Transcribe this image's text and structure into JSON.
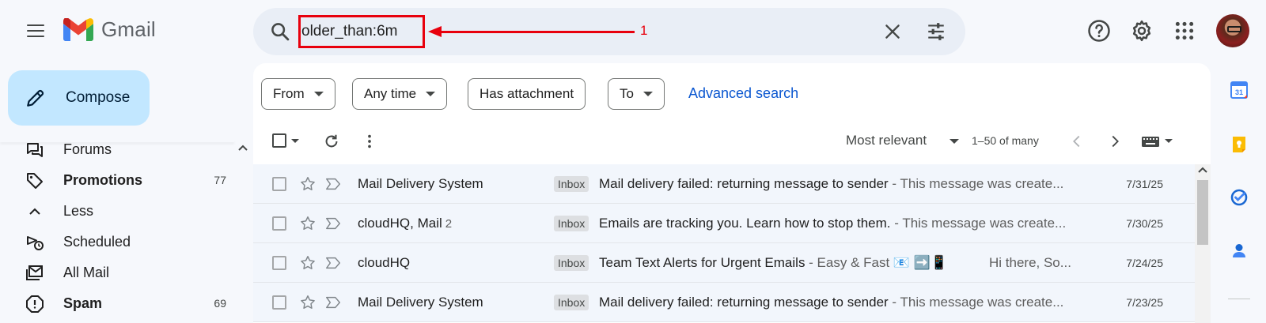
{
  "app": {
    "name": "Gmail",
    "brand_colors": {
      "red": "#ea4335",
      "blue": "#4285f4",
      "green": "#34a853",
      "yellow": "#fbbc04"
    }
  },
  "header": {
    "search_value": "older_than:6m",
    "icons": [
      "main-menu-icon",
      "search-icon",
      "clear-search-icon",
      "search-options-icon",
      "help-icon",
      "settings-icon",
      "google-apps-icon"
    ]
  },
  "annotation": {
    "number": "1",
    "color": "#e8000d"
  },
  "compose": {
    "label": "Compose"
  },
  "sidebar": {
    "items": [
      {
        "label": "Forums",
        "count": "",
        "bold": false,
        "icon": "forums-icon"
      },
      {
        "label": "Promotions",
        "count": "77",
        "bold": true,
        "icon": "promotions-icon"
      },
      {
        "label": "Less",
        "count": "",
        "bold": false,
        "icon": "chevron-up-icon"
      },
      {
        "label": "Scheduled",
        "count": "",
        "bold": false,
        "icon": "scheduled-icon"
      },
      {
        "label": "All Mail",
        "count": "",
        "bold": false,
        "icon": "all-mail-icon"
      },
      {
        "label": "Spam",
        "count": "69",
        "bold": true,
        "icon": "spam-icon"
      }
    ]
  },
  "filters": {
    "chips": [
      {
        "label": "From",
        "dropdown": true
      },
      {
        "label": "Any time",
        "dropdown": true
      },
      {
        "label": "Has attachment",
        "dropdown": false
      },
      {
        "label": "To",
        "dropdown": true
      }
    ],
    "advanced_link": "Advanced search"
  },
  "toolbar": {
    "sort_label": "Most relevant",
    "page_count": "1–50 of many"
  },
  "emails": [
    {
      "sender": "Mail Delivery System",
      "thread_count": "",
      "label": "Inbox",
      "subject": "Mail delivery failed: returning message to sender",
      "snippet": " - This message was create...",
      "extra": "",
      "date": "7/31/25"
    },
    {
      "sender": "cloudHQ, Mail",
      "thread_count": "2",
      "label": "Inbox",
      "subject": "Emails are tracking you. Learn how to stop them.",
      "snippet": " - This message was create...",
      "extra": "",
      "date": "7/30/25"
    },
    {
      "sender": "cloudHQ",
      "thread_count": "",
      "label": "Inbox",
      "subject": "Team Text Alerts for Urgent Emails",
      "snippet": " - Easy & Fast 📧 ➡️📱",
      "extra": "Hi there, So...",
      "date": "7/24/25"
    },
    {
      "sender": "Mail Delivery System",
      "thread_count": "",
      "label": "Inbox",
      "subject": "Mail delivery failed: returning message to sender",
      "snippet": " - This message was create...",
      "extra": "",
      "date": "7/23/25"
    }
  ],
  "right_rail": {
    "icons": [
      "calendar-icon",
      "keep-icon",
      "tasks-icon",
      "contacts-icon"
    ],
    "calendar_day": "31"
  }
}
